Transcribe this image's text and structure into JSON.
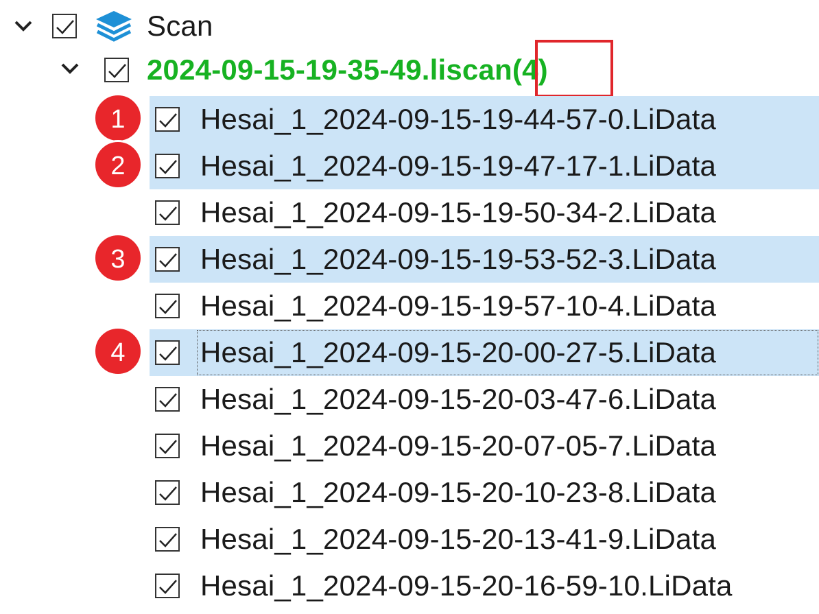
{
  "tree": {
    "root": {
      "label": "Scan",
      "checked": true,
      "expanded": true,
      "icon": "layers-icon"
    },
    "scan_file": {
      "name": "2024-09-15-19-35-49.liscan",
      "count": "(4)",
      "checked": true,
      "expanded": true,
      "color": "#17b222"
    },
    "items": [
      {
        "label": "Hesai_1_2024-09-15-19-44-57-0.LiData",
        "checked": true,
        "selected": true,
        "badge": "1"
      },
      {
        "label": "Hesai_1_2024-09-15-19-47-17-1.LiData",
        "checked": true,
        "selected": true,
        "badge": "2"
      },
      {
        "label": "Hesai_1_2024-09-15-19-50-34-2.LiData",
        "checked": true,
        "selected": false,
        "badge": ""
      },
      {
        "label": "Hesai_1_2024-09-15-19-53-52-3.LiData",
        "checked": true,
        "selected": true,
        "badge": "3"
      },
      {
        "label": "Hesai_1_2024-09-15-19-57-10-4.LiData",
        "checked": true,
        "selected": false,
        "badge": ""
      },
      {
        "label": "Hesai_1_2024-09-15-20-00-27-5.LiData",
        "checked": true,
        "selected": true,
        "focused": true,
        "badge": "4"
      },
      {
        "label": "Hesai_1_2024-09-15-20-03-47-6.LiData",
        "checked": true,
        "selected": false,
        "badge": ""
      },
      {
        "label": "Hesai_1_2024-09-15-20-07-05-7.LiData",
        "checked": true,
        "selected": false,
        "badge": ""
      },
      {
        "label": "Hesai_1_2024-09-15-20-10-23-8.LiData",
        "checked": true,
        "selected": false,
        "badge": ""
      },
      {
        "label": "Hesai_1_2024-09-15-20-13-41-9.LiData",
        "checked": true,
        "selected": false,
        "badge": ""
      },
      {
        "label": "Hesai_1_2024-09-15-20-16-59-10.LiData",
        "checked": true,
        "selected": false,
        "badge": ""
      }
    ]
  },
  "colors": {
    "selection": "#cce4f7",
    "badge": "#e8262b",
    "highlight_box": "#e0262b",
    "scan_file_text": "#17b222",
    "layers_icon": "#1e90d6"
  }
}
